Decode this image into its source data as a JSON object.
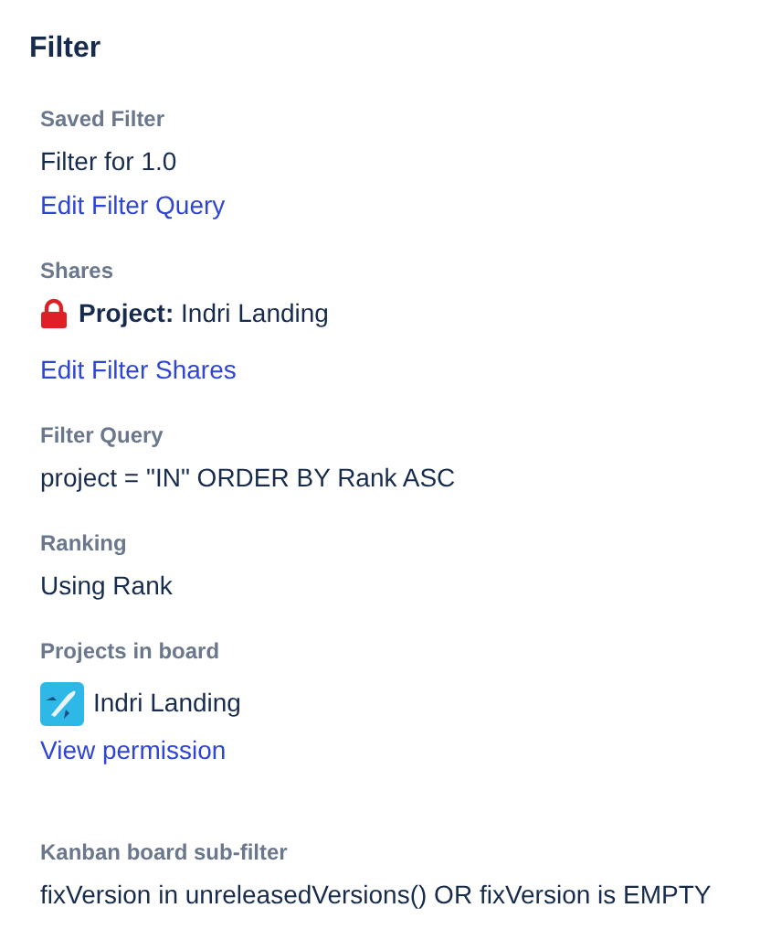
{
  "title": "Filter",
  "sections": [
    {
      "label": "Saved Filter",
      "items": [
        {
          "kind": "text",
          "text": "Filter for 1.0"
        },
        {
          "kind": "link",
          "text": "Edit Filter Query"
        }
      ]
    },
    {
      "label": "Shares",
      "items": [
        {
          "kind": "share",
          "bold": "Project:",
          "text": "Indri Landing"
        },
        {
          "kind": "link",
          "text": "Edit Filter Shares"
        }
      ]
    },
    {
      "label": "Filter Query",
      "items": [
        {
          "kind": "text",
          "text": "project = \"IN\" ORDER BY Rank ASC"
        }
      ]
    },
    {
      "label": "Ranking",
      "items": [
        {
          "kind": "text",
          "text": "Using Rank"
        }
      ]
    },
    {
      "label": "Projects in board",
      "items": [
        {
          "kind": "project",
          "text": "Indri Landing"
        },
        {
          "kind": "link",
          "text": "View permission"
        }
      ]
    },
    {
      "label": "Kanban board sub-filter",
      "items": [
        {
          "kind": "text",
          "text": "fixVersion in unreleasedVersions() OR fixVersion is EMPTY"
        }
      ]
    }
  ]
}
